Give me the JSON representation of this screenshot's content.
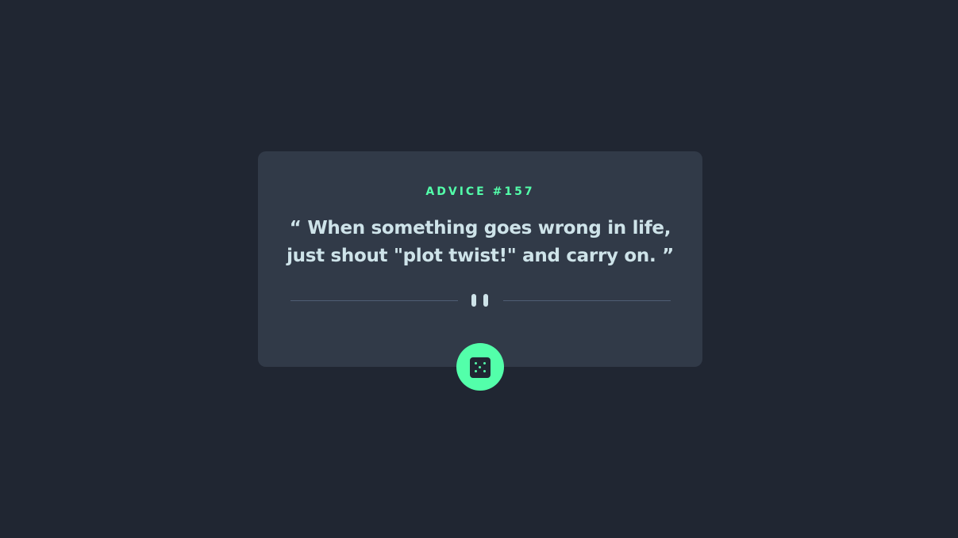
{
  "card": {
    "advice_label": "ADVICE #157",
    "advice_text": "“ When something goes wrong in life, just shout \"plot twist!\" and carry on. ”"
  },
  "divider": {
    "icon": "pause-icon"
  },
  "dice_button": {
    "icon": "dice-icon"
  },
  "colors": {
    "background": "#202632",
    "card": "#313a48",
    "accent": "#53ffaa",
    "text": "#cee3e9",
    "divider": "#4f5d74"
  }
}
